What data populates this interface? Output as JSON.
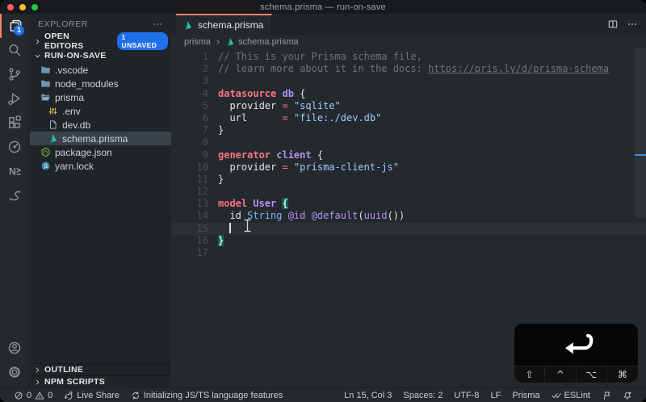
{
  "window": {
    "title": "schema.prisma — run-on-save"
  },
  "colors": {
    "accent_orange": "#f9826c",
    "badge_blue": "#1f6feb",
    "prisma_teal": "#2bc7b2"
  },
  "activity_bar": {
    "items": [
      {
        "name": "explorer",
        "icon": "files-icon",
        "active": true,
        "badge": "1"
      },
      {
        "name": "search",
        "icon": "search-icon"
      },
      {
        "name": "source-control",
        "icon": "git-branch-icon"
      },
      {
        "name": "run-debug",
        "icon": "run-debug-icon"
      },
      {
        "name": "extensions",
        "icon": "extensions-icon"
      },
      {
        "name": "extension-clock",
        "icon": "clock-icon"
      },
      {
        "name": "extension-n",
        "icon": "nx-icon"
      },
      {
        "name": "extension-swoosh",
        "icon": "swoosh-icon"
      }
    ],
    "bottom": [
      {
        "name": "account",
        "icon": "account-icon"
      },
      {
        "name": "settings",
        "icon": "gear-icon"
      }
    ]
  },
  "sidebar": {
    "title": "EXPLORER",
    "open_editors": {
      "label": "OPEN EDITORS",
      "badge": "1 UNSAVED"
    },
    "workspace_label": "RUN-ON-SAVE",
    "outline_label": "OUTLINE",
    "npm_scripts_label": "NPM SCRIPTS",
    "tree": [
      {
        "name": ".vscode",
        "icon": "folder-icon",
        "indent": 0
      },
      {
        "name": "node_modules",
        "icon": "folder-icon",
        "indent": 0
      },
      {
        "name": "prisma",
        "icon": "folder-open-icon",
        "indent": 0
      },
      {
        "name": ".env",
        "icon": "env-icon",
        "indent": 1
      },
      {
        "name": "dev.db",
        "icon": "file-icon",
        "indent": 1
      },
      {
        "name": "schema.prisma",
        "icon": "prisma-icon",
        "indent": 1,
        "selected": true
      },
      {
        "name": "package.json",
        "icon": "npm-icon",
        "indent": 0
      },
      {
        "name": "yarn.lock",
        "icon": "yarn-icon",
        "indent": 0
      }
    ]
  },
  "editor": {
    "tab": {
      "label": "schema.prisma",
      "icon": "prisma-icon",
      "dirty": true
    },
    "breadcrumb": {
      "folder": "prisma",
      "file": "schema.prisma"
    },
    "code": {
      "cursor": {
        "line": 15,
        "col": 3
      },
      "lines": [
        {
          "n": 1,
          "toks": [
            [
              "comment",
              "// This is your Prisma schema file,"
            ]
          ]
        },
        {
          "n": 2,
          "toks": [
            [
              "comment",
              "// learn more about it in the docs: "
            ],
            [
              "comment-link",
              "https://pris.ly/d/prisma-schema"
            ]
          ]
        },
        {
          "n": 3,
          "toks": []
        },
        {
          "n": 4,
          "toks": [
            [
              "keyword",
              "datasource "
            ],
            [
              "entity",
              "db "
            ],
            [
              "plain",
              "{"
            ]
          ]
        },
        {
          "n": 5,
          "toks": [
            [
              "plain",
              "  provider "
            ],
            [
              "op",
              "="
            ],
            [
              "plain",
              " "
            ],
            [
              "string",
              "\"sqlite\""
            ]
          ]
        },
        {
          "n": 6,
          "toks": [
            [
              "plain",
              "  url      "
            ],
            [
              "op",
              "="
            ],
            [
              "plain",
              " "
            ],
            [
              "string",
              "\"file:./dev.db\""
            ]
          ]
        },
        {
          "n": 7,
          "toks": [
            [
              "plain",
              "}"
            ]
          ]
        },
        {
          "n": 8,
          "toks": []
        },
        {
          "n": 9,
          "toks": [
            [
              "keyword",
              "generator "
            ],
            [
              "entity",
              "client "
            ],
            [
              "plain",
              "{"
            ]
          ]
        },
        {
          "n": 10,
          "toks": [
            [
              "plain",
              "  provider "
            ],
            [
              "op",
              "="
            ],
            [
              "plain",
              " "
            ],
            [
              "string",
              "\"prisma-client-js\""
            ]
          ]
        },
        {
          "n": 11,
          "toks": [
            [
              "plain",
              "}"
            ]
          ]
        },
        {
          "n": 12,
          "toks": []
        },
        {
          "n": 13,
          "toks": [
            [
              "keyword",
              "model "
            ],
            [
              "entity",
              "User "
            ],
            [
              "bracket",
              "{"
            ]
          ]
        },
        {
          "n": 14,
          "toks": [
            [
              "plain",
              "  id "
            ],
            [
              "type",
              "String "
            ],
            [
              "attr",
              "@id"
            ],
            [
              "plain",
              " "
            ],
            [
              "attr",
              "@default"
            ],
            [
              "plain",
              "("
            ],
            [
              "attr",
              "uuid"
            ],
            [
              "plain",
              "())"
            ]
          ]
        },
        {
          "n": 15,
          "toks": [
            [
              "plain",
              "  "
            ]
          ],
          "cursor": true,
          "current": true
        },
        {
          "n": 16,
          "toks": [
            [
              "bracket",
              "}"
            ]
          ]
        },
        {
          "n": 17,
          "toks": []
        }
      ]
    }
  },
  "status_bar": {
    "left": [
      {
        "name": "problems",
        "parts": [
          {
            "icon": "error-icon"
          },
          {
            "text": "0"
          },
          {
            "icon": "warning-icon"
          },
          {
            "text": "0"
          }
        ]
      },
      {
        "name": "live-share",
        "parts": [
          {
            "icon": "live-share-icon"
          },
          {
            "text": "Live Share"
          }
        ]
      },
      {
        "name": "ts-init",
        "parts": [
          {
            "icon": "sync-icon"
          },
          {
            "text": "Initializing JS/TS language features"
          }
        ]
      }
    ],
    "right": [
      {
        "name": "cursor-position",
        "parts": [
          {
            "text": "Ln 15, Col 3"
          }
        ]
      },
      {
        "name": "indentation",
        "parts": [
          {
            "text": "Spaces: 2"
          }
        ]
      },
      {
        "name": "encoding",
        "parts": [
          {
            "text": "UTF-8"
          }
        ]
      },
      {
        "name": "eol",
        "parts": [
          {
            "text": "LF"
          }
        ]
      },
      {
        "name": "language-mode",
        "parts": [
          {
            "text": "Prisma"
          }
        ]
      },
      {
        "name": "eslint",
        "parts": [
          {
            "icon": "double-check-icon"
          },
          {
            "text": "ESLint"
          }
        ]
      },
      {
        "name": "feedback",
        "parts": [
          {
            "icon": "feedback-icon"
          }
        ]
      },
      {
        "name": "notifications",
        "parts": [
          {
            "icon": "bell-icon"
          }
        ]
      }
    ]
  },
  "key_overlay": {
    "primary_key": "return-arrow",
    "modifiers": [
      "⇧",
      "^",
      "⌥",
      "⌘"
    ]
  }
}
